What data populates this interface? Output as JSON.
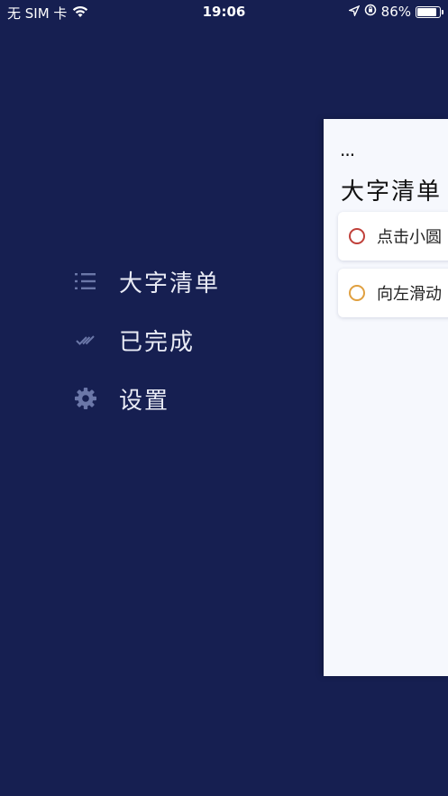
{
  "status_bar": {
    "carrier": "无 SIM 卡",
    "time": "19:06",
    "battery_percent": "86%",
    "battery_level": 0.86,
    "icons": [
      "wifi-icon",
      "location-arrow-icon",
      "orientation-lock-icon",
      "battery-icon"
    ]
  },
  "menu": {
    "items": [
      {
        "label": "大字清单",
        "icon": "list-icon"
      },
      {
        "label": "已完成",
        "icon": "double-check-icon"
      },
      {
        "label": "设置",
        "icon": "gear-icon"
      }
    ]
  },
  "panel": {
    "more_label": "...",
    "title": "大字清单",
    "tasks": [
      {
        "text": "点击小圆",
        "circle_color": "#c0403a"
      },
      {
        "text": "向左滑动",
        "circle_color": "#e0a040"
      }
    ]
  },
  "colors": {
    "background": "#161f51",
    "panel_background": "#f6f8fd",
    "menu_icon": "#6b77a8"
  }
}
